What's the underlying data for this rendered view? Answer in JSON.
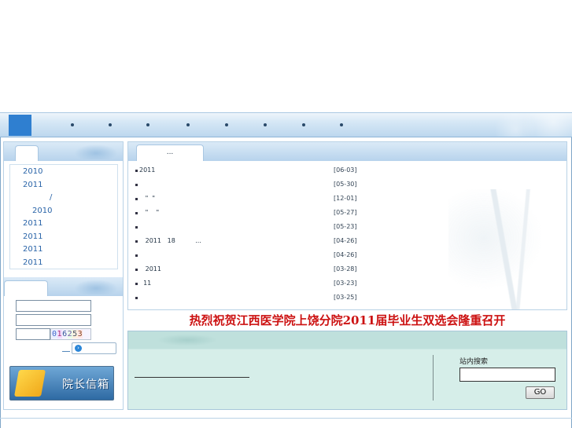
{
  "nav": {
    "separators": 8
  },
  "left": {
    "years": [
      "2010",
      "2011",
      "/",
      "2010",
      "2011",
      "2011",
      "2011",
      "2011"
    ],
    "captcha_digits": [
      "0",
      "1",
      "6",
      "2",
      "5",
      "3"
    ],
    "mailbox_label": "院长信箱"
  },
  "news": {
    "tab_label": "...",
    "items": [
      {
        "title": "2011",
        "date": "[06-03]"
      },
      {
        "title": "",
        "date": "[05-30]"
      },
      {
        "title": "   \"  \"",
        "date": "[12-01]"
      },
      {
        "title": "   \"    \"",
        "date": "[05-27]"
      },
      {
        "title": "",
        "date": "[05-23]"
      },
      {
        "title": "   2011   18          ...",
        "date": "[04-26]"
      },
      {
        "title": "",
        "date": "[04-26]"
      },
      {
        "title": "   2011",
        "date": "[03-28]"
      },
      {
        "title": "  11",
        "date": "[03-23]"
      },
      {
        "title": "",
        "date": "[03-25]"
      }
    ]
  },
  "banner_text": "热烈祝贺江西医学院上饶分院2011届毕业生双选会隆重召开",
  "search": {
    "label": "站内搜索",
    "button": "GO"
  },
  "colors": {
    "accent": "#2f7fd0",
    "headline": "#cc1111",
    "panel_green": "#d6eee9"
  }
}
